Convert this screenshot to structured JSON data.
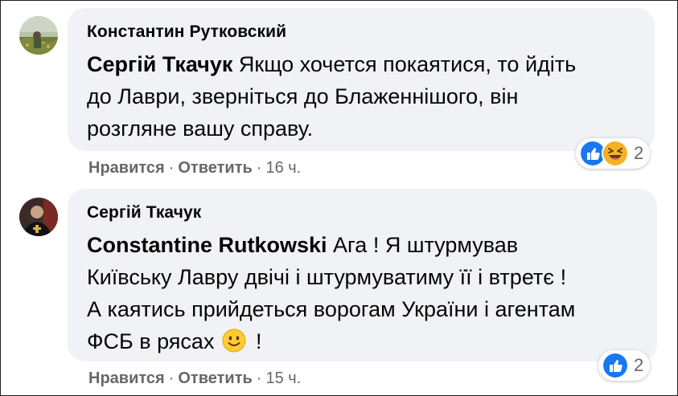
{
  "comments": [
    {
      "author": "Константин Рутковский",
      "mention": "Сергій Ткачук",
      "lines": [
        " Якщо хочется покаятися, то йдіть",
        "до Лаври, зверніться до Блаженнішого, він",
        "розгляне вашу справу."
      ],
      "reactions": {
        "types": [
          "like-icon",
          "haha-icon"
        ],
        "count": "2"
      },
      "actions": {
        "like": "Нравится",
        "reply": "Ответить",
        "time": "16 ч."
      }
    },
    {
      "author": "Сергій Ткачук",
      "mention": "Constantine Rutkowski",
      "lines": [
        " Ага ! Я штурмував",
        "Київську Лавру двічі і штурмуватиму її і втретє !",
        "А каятись прийдеться ворогам України і агентам",
        "ФСБ в рясах",
        " !"
      ],
      "reactions": {
        "types": [
          "like-icon"
        ],
        "count": "2"
      },
      "actions": {
        "like": "Нравится",
        "reply": "Ответить",
        "time": "15 ч."
      }
    }
  ],
  "separator": "·",
  "colors": {
    "bubble": "#f0f2f5",
    "muted_text": "#65676b",
    "like_blue": "#1877f2",
    "haha_yellow": "#f7b125"
  }
}
